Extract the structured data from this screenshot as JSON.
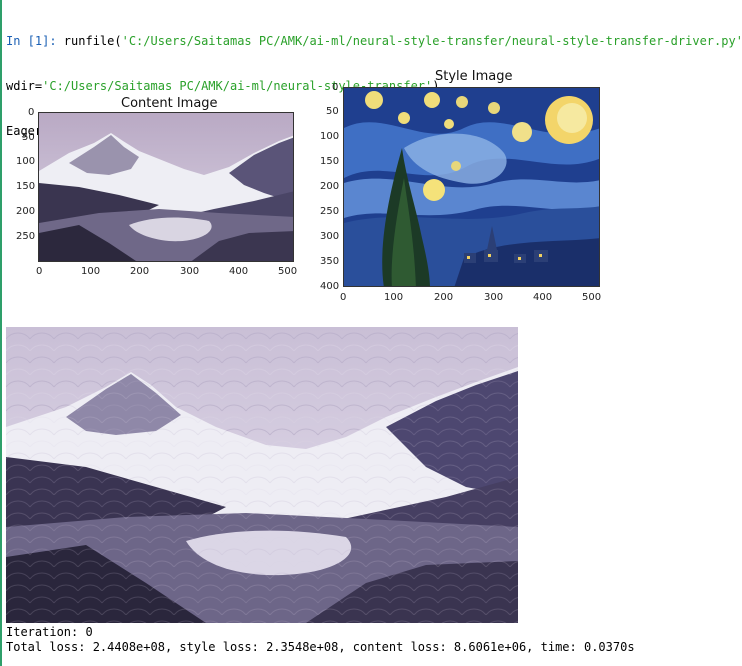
{
  "console": {
    "prompt": "In [1]:",
    "line1_pre": " runfile(",
    "line1_path": "'C:/Users/Saitamas PC/AMK/ai-ml/neural-style-transfer/neural-style-transfer-driver.py'",
    "line1_post": ",",
    "line2_pre": "wdir=",
    "line2_path": "'C:/Users/Saitamas PC/AMK/ai-ml/neural-style-transfer'",
    "line2_post": ")",
    "line3": "Eager execution: True"
  },
  "content_plot": {
    "title": "Content Image",
    "x_ticks": [
      "0",
      "100",
      "200",
      "300",
      "400",
      "500"
    ],
    "y_ticks": [
      "0",
      "50",
      "100",
      "150",
      "200",
      "250"
    ]
  },
  "style_plot": {
    "title": "Style Image",
    "x_ticks": [
      "0",
      "100",
      "200",
      "300",
      "400",
      "500"
    ],
    "y_ticks": [
      "0",
      "50",
      "100",
      "150",
      "200",
      "250",
      "300",
      "350",
      "400"
    ]
  },
  "output": {
    "iteration": "Iteration: 0",
    "loss": "Total loss: 2.4408e+08, style loss: 2.3548e+08, content loss: 8.6061e+06, time: 0.0370s"
  },
  "colors": {
    "prompt": "#1a5fb4",
    "string": "#2aa12a",
    "panel_border": "#2e9f6a"
  }
}
